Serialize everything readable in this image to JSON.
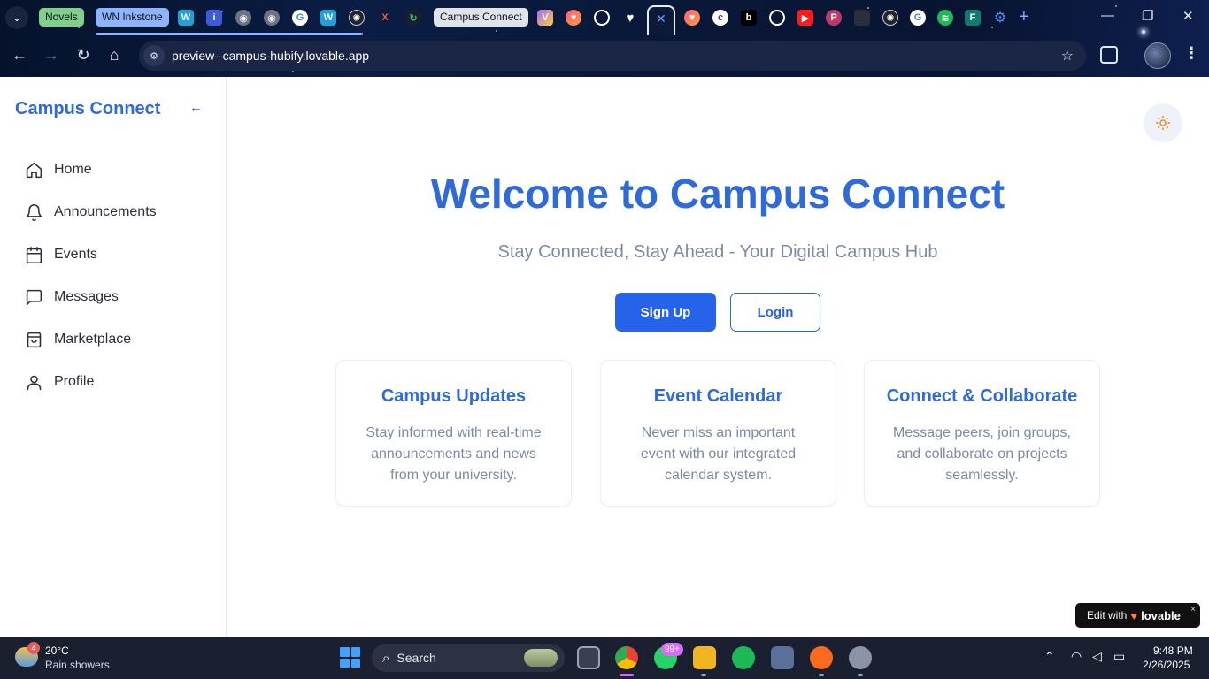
{
  "browser": {
    "tab_groups": [
      {
        "label": "Novels",
        "color": "#7ed08a"
      },
      {
        "label": "WN Inkstone",
        "color": "#8fb4ff"
      },
      {
        "label": "Campus Connect",
        "color": "#dfe3ea"
      }
    ],
    "address": "preview--campus-hubify.lovable.app",
    "icons": [
      "tab-search-icon",
      "back-icon",
      "forward-icon",
      "reload-icon",
      "home-icon",
      "site-info-icon",
      "bookmark-star-icon",
      "extensions-icon",
      "profile-avatar",
      "menu-icon",
      "minimize-icon",
      "restore-icon",
      "close-icon"
    ]
  },
  "app": {
    "brand": "Campus Connect",
    "collapse_glyph": "←",
    "nav": [
      {
        "label": "Home",
        "icon": "home-icon"
      },
      {
        "label": "Announcements",
        "icon": "bell-icon"
      },
      {
        "label": "Events",
        "icon": "calendar-icon"
      },
      {
        "label": "Messages",
        "icon": "message-icon"
      },
      {
        "label": "Marketplace",
        "icon": "shopping-bag-icon"
      },
      {
        "label": "Profile",
        "icon": "user-icon"
      }
    ],
    "theme_toggle_icon": "sun-icon",
    "accent_color": "#2f6ad9",
    "hero": {
      "title": "Welcome to Campus Connect",
      "subtitle": "Stay Connected, Stay Ahead - Your Digital Campus Hub",
      "signup_label": "Sign Up",
      "login_label": "Login"
    },
    "features": [
      {
        "title": "Campus Updates",
        "text": "Stay informed with real-time announcements and news from your university."
      },
      {
        "title": "Event Calendar",
        "text": "Never miss an important event with our integrated calendar system."
      },
      {
        "title": "Connect & Collaborate",
        "text": "Message peers, join groups, and collaborate on projects seamlessly."
      }
    ],
    "badge": {
      "prefix": "Edit with",
      "name": "lovable",
      "close": "×"
    }
  },
  "taskbar": {
    "weather_badge": "4",
    "temperature": "20°C",
    "condition": "Rain showers",
    "search_label": "Search",
    "whatsapp_badge": "99+",
    "time": "9:48 PM",
    "date": "2/26/2025"
  }
}
